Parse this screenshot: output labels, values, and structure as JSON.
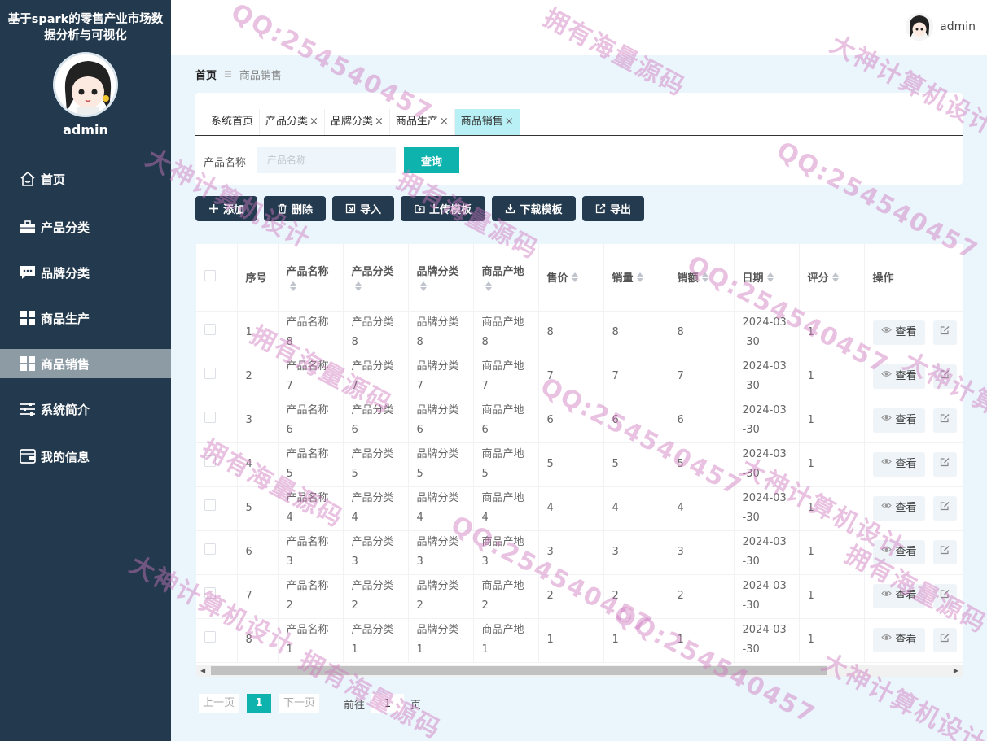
{
  "sidebar": {
    "title_line1": "基于spark的零售产业市场数",
    "title_line2": "据分析与可视化",
    "username": "admin",
    "items": [
      {
        "label": "首页",
        "icon": "home-icon"
      },
      {
        "label": "产品分类",
        "icon": "briefcase-icon"
      },
      {
        "label": "品牌分类",
        "icon": "chat-icon"
      },
      {
        "label": "商品生产",
        "icon": "grid-icon"
      },
      {
        "label": "商品销售",
        "icon": "grid-icon",
        "active": true
      },
      {
        "label": "系统简介",
        "icon": "sliders-icon"
      },
      {
        "label": "我的信息",
        "icon": "wallet-icon"
      }
    ]
  },
  "header": {
    "username": "admin"
  },
  "breadcrumb": {
    "home": "首页",
    "current": "商品销售"
  },
  "tabs": [
    "系统首页",
    "产品分类",
    "品牌分类",
    "商品生产",
    "商品销售"
  ],
  "tab_close": "×",
  "search": {
    "label": "产品名称",
    "placeholder": "产品名称",
    "button": "查询"
  },
  "actions": {
    "add": "添加",
    "delete": "删除",
    "import": "导入",
    "upload_template": "上传模板",
    "download_template": "下载模板",
    "export": "导出"
  },
  "table": {
    "headers": {
      "index": "序号",
      "name": "产品名称",
      "category": "产品分类",
      "brand": "品牌分类",
      "origin": "商品产地",
      "price": "售价",
      "volume": "销量",
      "amount": "销额",
      "date": "日期",
      "rating": "评分",
      "ops": "操作"
    },
    "view_label": "查看",
    "rows": [
      {
        "index": "1",
        "name_a": "产品名称",
        "name_b": "8",
        "cat_a": "产品分类",
        "cat_b": "8",
        "brand_a": "品牌分类",
        "brand_b": "8",
        "origin_a": "商品产地",
        "origin_b": "8",
        "price": "8",
        "volume": "8",
        "amount": "8",
        "date_a": "2024-03",
        "date_b": "-30",
        "rating": "1"
      },
      {
        "index": "2",
        "name_a": "产品名称",
        "name_b": "7",
        "cat_a": "产品分类",
        "cat_b": "7",
        "brand_a": "品牌分类",
        "brand_b": "7",
        "origin_a": "商品产地",
        "origin_b": "7",
        "price": "7",
        "volume": "7",
        "amount": "7",
        "date_a": "2024-03",
        "date_b": "-30",
        "rating": "1"
      },
      {
        "index": "3",
        "name_a": "产品名称",
        "name_b": "6",
        "cat_a": "产品分类",
        "cat_b": "6",
        "brand_a": "品牌分类",
        "brand_b": "6",
        "origin_a": "商品产地",
        "origin_b": "6",
        "price": "6",
        "volume": "6",
        "amount": "6",
        "date_a": "2024-03",
        "date_b": "-30",
        "rating": "1"
      },
      {
        "index": "4",
        "name_a": "产品名称",
        "name_b": "5",
        "cat_a": "产品分类",
        "cat_b": "5",
        "brand_a": "品牌分类",
        "brand_b": "5",
        "origin_a": "商品产地",
        "origin_b": "5",
        "price": "5",
        "volume": "5",
        "amount": "5",
        "date_a": "2024-03",
        "date_b": "-30",
        "rating": "1"
      },
      {
        "index": "5",
        "name_a": "产品名称",
        "name_b": "4",
        "cat_a": "产品分类",
        "cat_b": "4",
        "brand_a": "品牌分类",
        "brand_b": "4",
        "origin_a": "商品产地",
        "origin_b": "4",
        "price": "4",
        "volume": "4",
        "amount": "4",
        "date_a": "2024-03",
        "date_b": "-30",
        "rating": "1"
      },
      {
        "index": "6",
        "name_a": "产品名称",
        "name_b": "3",
        "cat_a": "产品分类",
        "cat_b": "3",
        "brand_a": "品牌分类",
        "brand_b": "3",
        "origin_a": "商品产地",
        "origin_b": "3",
        "price": "3",
        "volume": "3",
        "amount": "3",
        "date_a": "2024-03",
        "date_b": "-30",
        "rating": "1"
      },
      {
        "index": "7",
        "name_a": "产品名称",
        "name_b": "2",
        "cat_a": "产品分类",
        "cat_b": "2",
        "brand_a": "品牌分类",
        "brand_b": "2",
        "origin_a": "商品产地",
        "origin_b": "2",
        "price": "2",
        "volume": "2",
        "amount": "2",
        "date_a": "2024-03",
        "date_b": "-30",
        "rating": "1"
      },
      {
        "index": "8",
        "name_a": "产品名称",
        "name_b": "1",
        "cat_a": "产品分类",
        "cat_b": "1",
        "brand_a": "品牌分类",
        "brand_b": "1",
        "origin_a": "商品产地",
        "origin_b": "1",
        "price": "1",
        "volume": "1",
        "amount": "1",
        "date_a": "2024-03",
        "date_b": "-30",
        "rating": "1"
      }
    ]
  },
  "pagination": {
    "prev": "上一页",
    "current": "1",
    "next": "下一页",
    "goto": "前往",
    "goto_value": "1",
    "unit": "页"
  },
  "watermarks": [
    "QQ:254540457",
    "拥有海量源码",
    "大神计算机设计"
  ],
  "colors": {
    "sidebar": "#233a4e",
    "accent": "#0fb3ae",
    "action_button": "#243a4f",
    "active_tab": "#b8f0f5",
    "background": "#eaf5fc"
  }
}
